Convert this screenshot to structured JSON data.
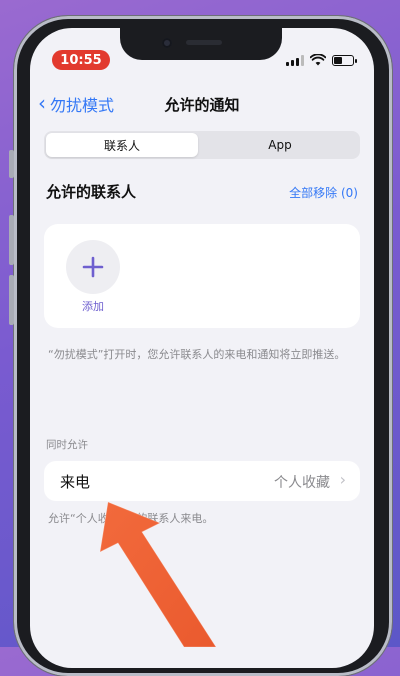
{
  "status": {
    "time": "10:55"
  },
  "nav": {
    "back_label": "勿扰模式",
    "title": "允许的通知"
  },
  "tabs": [
    {
      "label": "联系人",
      "active": true
    },
    {
      "label": "App",
      "active": false
    }
  ],
  "contacts": {
    "title": "允许的联系人",
    "remove_all": "全部移除 (0)",
    "add_label": "添加",
    "footnote": "“勿扰模式”打开时，您允许联系人的来电和通知将立即推送。"
  },
  "also_allow": {
    "section_label": "同时允许",
    "calls": {
      "label": "来电",
      "value": "个人收藏"
    },
    "footnote": "允许“个人收藏”中的联系人来电。"
  },
  "colors": {
    "accent": "#3478f6",
    "add_icon": "#6e5fcf",
    "time_pill": "#e23a2e",
    "arrow": "#f26a3c"
  },
  "icons": {
    "back": "chevron-left",
    "add": "plus",
    "row": "chevron-right",
    "battery_level": 0.45
  }
}
